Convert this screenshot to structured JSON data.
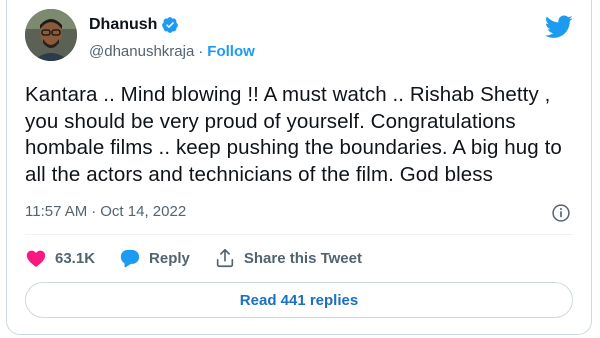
{
  "author": {
    "name": "Dhanush",
    "handle": "@dhanushkraja",
    "separator": "·",
    "follow_label": "Follow"
  },
  "tweet": {
    "text": "Kantara ..  Mind blowing !! A must watch .. Rishab Shetty , you should be very proud of yourself. Congratulations hombale films .. keep pushing the boundaries. A big hug to all the actors and technicians of the film. God bless",
    "time": "11:57 AM",
    "separator": "·",
    "date": "Oct 14, 2022"
  },
  "actions": {
    "likes": "63.1K",
    "reply_label": "Reply",
    "share_label": "Share this Tweet"
  },
  "read_replies_label": "Read 441 replies",
  "colors": {
    "accent": "#1d9bf0",
    "like": "#f91880",
    "muted": "#536471",
    "border": "#cfd9de"
  },
  "icons": {
    "verified": "verified-badge-icon",
    "brand": "twitter-bird-icon",
    "info": "info-icon",
    "like": "heart-icon",
    "reply": "speech-bubble-icon",
    "share": "share-upload-icon"
  }
}
